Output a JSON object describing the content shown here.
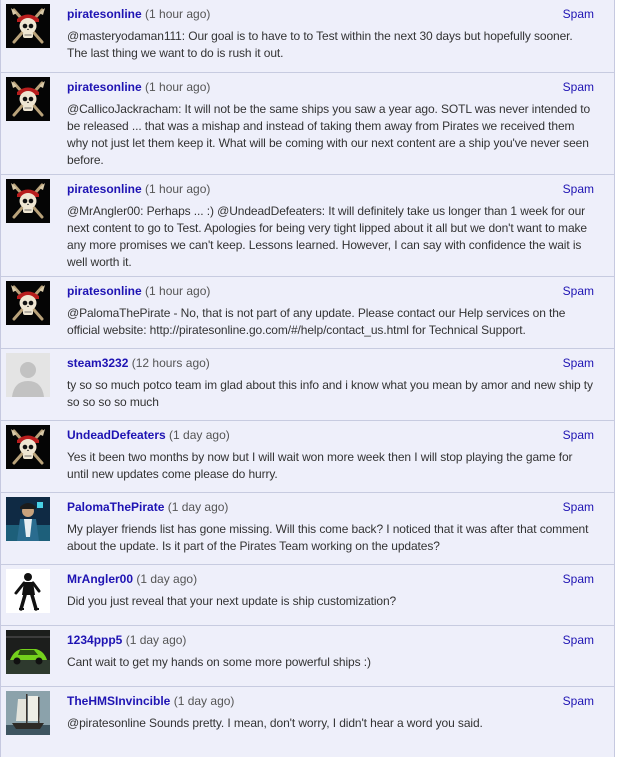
{
  "spam_label": "Spam",
  "comments": [
    {
      "author": "piratesonline",
      "time": "(1 hour ago)",
      "text": "@masteryodaman111: Our goal is to have to to Test within the next 30 days but hopefully sooner. The last thing we want to do is rush it out.",
      "avatar": "pirate-skull-avatar-icon"
    },
    {
      "author": "piratesonline",
      "time": "(1 hour ago)",
      "text": "@CallicoJackracham: It will not be the same ships you saw a year ago. SOTL was never intended to be released ... that was a mishap and instead of taking them away from Pirates we received them why not just let them keep it. What will be coming with our next content are a ship you've never seen before.",
      "avatar": "pirate-skull-avatar-icon"
    },
    {
      "author": "piratesonline",
      "time": "(1 hour ago)",
      "text": "@MrAngler00: Perhaps ... :) @UndeadDefeaters: It will definitely take us longer than 1 week for our next content to go to Test. Apologies for being very tight lipped about it all but we don't want to make any more promises we can't keep. Lessons learned. However, I can say with confidence the wait is well worth it.",
      "avatar": "pirate-skull-avatar-icon"
    },
    {
      "author": "piratesonline",
      "time": "(1 hour ago)",
      "text": "@PalomaThePirate - No, that is not part of any update. Please contact our Help services on the official website: http://piratesonline.go.com/#/help/contact_us.html for Technical Support.",
      "avatar": "pirate-skull-avatar-icon"
    },
    {
      "author": "steam3232",
      "time": "(12 hours ago)",
      "text": "ty so so much potco team im glad about this info and i know what you mean by amor and new ship ty so so so so much",
      "avatar": "default-user-avatar-icon"
    },
    {
      "author": "UndeadDefeaters",
      "time": "(1 day ago)",
      "text": "Yes it been two months by now but I will wait won more week then I will stop playing the game for until new updates come please do hurry.",
      "avatar": "pirate-skull-avatar-icon"
    },
    {
      "author": "PalomaThePirate",
      "time": "(1 day ago)",
      "text": "My player friends list has gone missing. Will this come back? I noticed that it was after that comment about the update. Is it part of the Pirates Team working on the updates?",
      "avatar": "pirate-character-avatar-icon"
    },
    {
      "author": "MrAngler00",
      "time": "(1 day ago)",
      "text": "Did you just reveal that your next update is ship customization?",
      "avatar": "dancer-avatar-icon"
    },
    {
      "author": "1234ppp5",
      "time": "(1 day ago)",
      "text": "Cant wait to get my hands on some more powerful ships :)",
      "avatar": "green-car-avatar-icon"
    },
    {
      "author": "TheHMSInvincible",
      "time": "(1 day ago)",
      "text": "@piratesonline Sounds pretty. I mean, don't worry, I didn't hear a word you said.",
      "avatar": "sailing-ship-avatar-icon"
    }
  ]
}
